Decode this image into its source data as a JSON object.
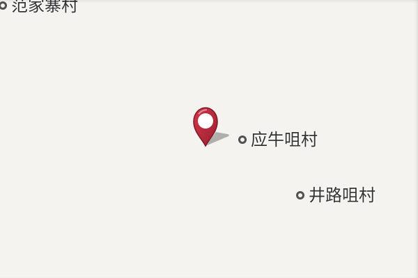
{
  "map": {
    "places": [
      {
        "name": "范家寨村",
        "icon": "village-dot-icon"
      },
      {
        "name": "应牛咀村",
        "icon": "village-dot-icon"
      },
      {
        "name": "井路咀村",
        "icon": "village-dot-icon"
      }
    ],
    "marker": {
      "icon": "map-pin-icon",
      "color": "#b02a3a"
    },
    "colors": {
      "background": "#f4f3ef",
      "label": "#333333",
      "dot": "#505050"
    }
  }
}
